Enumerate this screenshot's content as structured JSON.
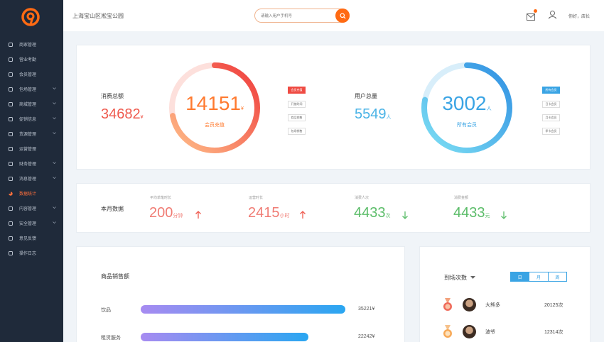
{
  "colors": {
    "accent": "#ff6a13",
    "red": "#ef4b43",
    "blue": "#3aa4e4",
    "green": "#5cbd6a",
    "sidebar_bg": "#1f2a3a"
  },
  "header": {
    "location": "上海宝山区淞宝公园",
    "search_placeholder": "请输入用户手机号",
    "greeting": "你好，店长"
  },
  "sidebar": {
    "items": [
      {
        "label": "商家管理",
        "icon": "store-icon"
      },
      {
        "label": "营业考勤",
        "icon": "chart-icon"
      },
      {
        "label": "会员管理",
        "icon": "vip-icon"
      },
      {
        "label": "包场管理",
        "icon": "venue-icon"
      },
      {
        "label": "商城管理",
        "icon": "mall-icon"
      },
      {
        "label": "促销信息",
        "icon": "promo-icon"
      },
      {
        "label": "货源管理",
        "icon": "cart-icon"
      },
      {
        "label": "运营管理",
        "icon": "ops-icon"
      },
      {
        "label": "财务管理",
        "icon": "finance-icon"
      },
      {
        "label": "消息管理",
        "icon": "message-icon"
      },
      {
        "label": "数据统计",
        "icon": "pie-icon"
      },
      {
        "label": "内容管理",
        "icon": "content-icon"
      },
      {
        "label": "安全管理",
        "icon": "shield-icon"
      },
      {
        "label": "意见反馈",
        "icon": "feedback-icon"
      },
      {
        "label": "操作日志",
        "icon": "log-icon"
      }
    ]
  },
  "overview": {
    "consumption_label": "消费总额",
    "consumption_value": "34682",
    "consumption_unit": "¥",
    "ring1_value": "14151",
    "ring1_unit": "¥",
    "ring1_caption": "会员充值",
    "ring1_fill": 0.72,
    "ring1_tags": [
      "会员充值",
      "开放时间",
      "商品销售",
      "包场销售"
    ],
    "users_label": "用户总量",
    "users_value": "5549",
    "users_unit": "人",
    "ring2_value": "3002",
    "ring2_unit": "人",
    "ring2_caption": "所有会员",
    "ring2_fill": 0.78,
    "ring2_tags": [
      "所有会员",
      "日卡会员",
      "月卡会员",
      "季卡会员"
    ]
  },
  "month": {
    "title": "本月数据",
    "stats": [
      {
        "caption": "平均单笔时长",
        "value": "200",
        "unit": "分钟",
        "trend": "up"
      },
      {
        "caption": "运营时长",
        "value": "2415",
        "unit": "小时",
        "trend": "up"
      },
      {
        "caption": "消费人次",
        "value": "4433",
        "unit": "次",
        "trend": "down"
      },
      {
        "caption": "消费金额",
        "value": "4433",
        "unit": "元",
        "trend": "down"
      }
    ]
  },
  "sales": {
    "title": "商品销售额",
    "rows": [
      {
        "label": "饮品",
        "value": "35221¥",
        "fraction": 1.0
      },
      {
        "label": "租赁服务",
        "value": "22242¥",
        "fraction": 0.82
      }
    ]
  },
  "visits": {
    "title": "到场次数",
    "segments": [
      "日",
      "月",
      "周"
    ],
    "ranks": [
      {
        "name": "大熊多",
        "count": "20125次"
      },
      {
        "name": "波爷",
        "count": "12314次"
      }
    ]
  }
}
